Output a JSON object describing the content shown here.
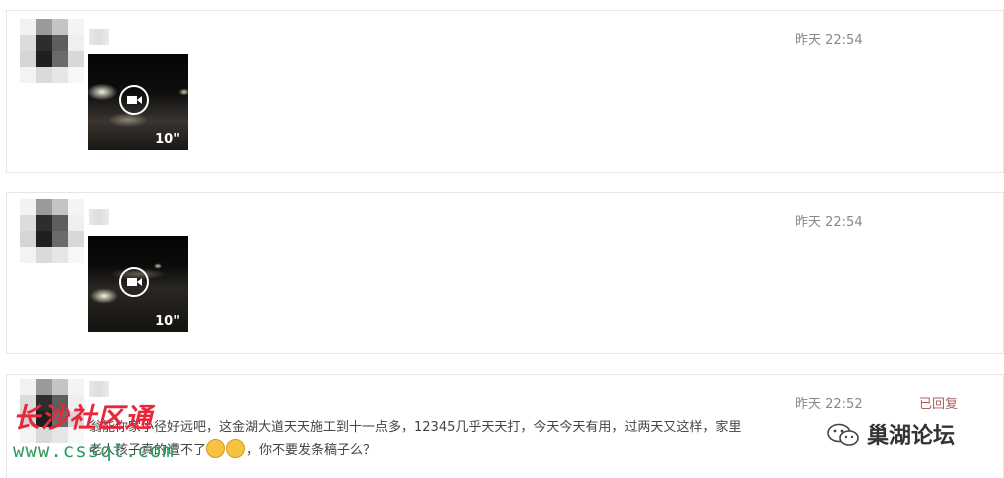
{
  "posts": [
    {
      "time": "昨天 22:54",
      "video": {
        "duration": "10\""
      }
    },
    {
      "time": "昨天 22:54",
      "video": {
        "duration": "10\""
      }
    },
    {
      "time": "昨天 22:52",
      "status": "已回复",
      "comment_line1": "翁能你家小径好远吧，这金湖大道天天施工到十一点多，12345几乎天天打，今天今天有用，过两天又这样，家里",
      "comment_line2_a": "老人孩子真的遭不了",
      "comment_line2_b": "，你不要发条稿子么？"
    }
  ],
  "watermarks": {
    "site_name": "长沙社区通",
    "site_url": "www.cssqt.com",
    "forum_name": "巢湖论坛"
  },
  "icons": [
    "play-video-icon",
    "emoji-icon",
    "wechat-icon"
  ],
  "colors": {
    "time": "#888888",
    "status": "#a86060",
    "watermark_red": "#e8283a",
    "watermark_green": "#2b9a5a"
  }
}
